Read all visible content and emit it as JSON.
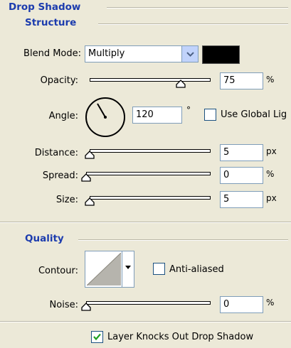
{
  "section_title": "Drop Shadow",
  "structure": {
    "title": "Structure",
    "blend_mode": {
      "label": "Blend Mode:",
      "value": "Multiply",
      "color": "#000000"
    },
    "opacity": {
      "label": "Opacity:",
      "value": "75",
      "unit": "%",
      "level": 0.75
    },
    "angle": {
      "label": "Angle:",
      "value": "120",
      "unit": "°",
      "degrees": 120
    },
    "use_global_light": {
      "label": "Use Global Lig",
      "checked": false
    },
    "distance": {
      "label": "Distance:",
      "value": "5",
      "unit": "px",
      "level": 0.0
    },
    "spread": {
      "label": "Spread:",
      "value": "0",
      "unit": "%",
      "level": 0.0
    },
    "size": {
      "label": "Size:",
      "value": "5",
      "unit": "px",
      "level": 0.0
    }
  },
  "quality": {
    "title": "Quality",
    "contour": {
      "label": "Contour:"
    },
    "anti_aliased": {
      "label": "Anti-aliased",
      "checked": false
    },
    "noise": {
      "label": "Noise:",
      "value": "0",
      "unit": "%",
      "level": 0.0
    }
  },
  "layer_knocks_out": {
    "label": "Layer Knocks Out Drop Shadow",
    "checked": true
  },
  "colors": {
    "panel_bg": "#ece9d8",
    "header_blue": "#1c3cae",
    "field_border": "#7f9db9",
    "check_green": "#21a121"
  }
}
